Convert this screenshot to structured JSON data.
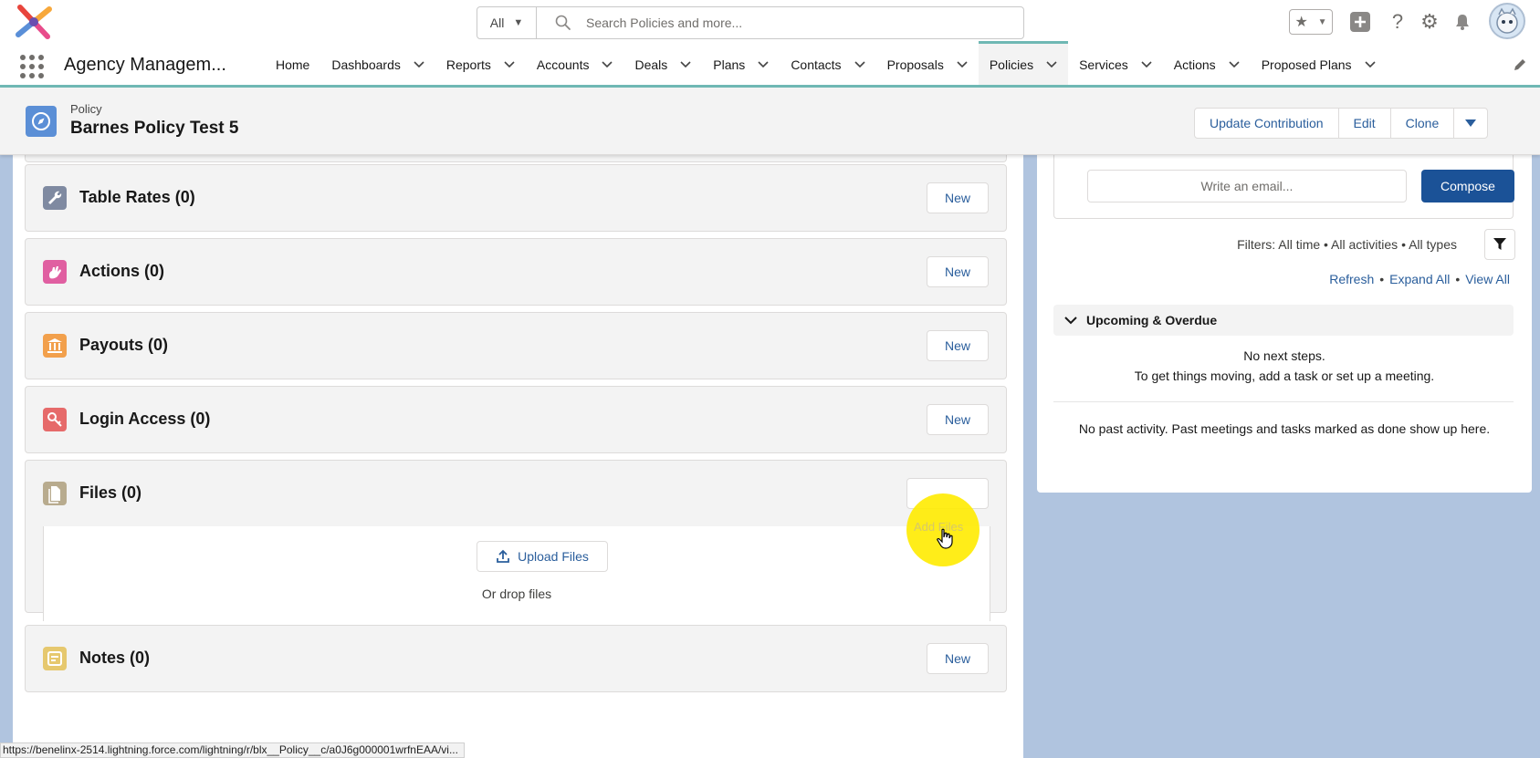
{
  "search": {
    "scope": "All",
    "placeholder": "Search Policies and more..."
  },
  "app": {
    "name": "Agency Managem..."
  },
  "nav": {
    "items": [
      {
        "label": "Home",
        "has_menu": false
      },
      {
        "label": "Dashboards",
        "has_menu": true
      },
      {
        "label": "Reports",
        "has_menu": true
      },
      {
        "label": "Accounts",
        "has_menu": true
      },
      {
        "label": "Deals",
        "has_menu": true
      },
      {
        "label": "Plans",
        "has_menu": true
      },
      {
        "label": "Contacts",
        "has_menu": true
      },
      {
        "label": "Proposals",
        "has_menu": true
      },
      {
        "label": "Policies",
        "has_menu": true,
        "active": true
      },
      {
        "label": "Services",
        "has_menu": true
      },
      {
        "label": "Actions",
        "has_menu": true
      },
      {
        "label": "Proposed Plans",
        "has_menu": true
      }
    ]
  },
  "record": {
    "type": "Policy",
    "title": "Barnes Policy Test 5",
    "actions": [
      "Update Contribution",
      "Edit",
      "Clone"
    ]
  },
  "related": [
    {
      "title": "Table Rates (0)",
      "button": "New",
      "icon": "wrench-icon",
      "color": "#7f8aa1"
    },
    {
      "title": "Actions (0)",
      "button": "New",
      "icon": "hand-icon",
      "color": "#e05fa1"
    },
    {
      "title": "Payouts (0)",
      "button": "New",
      "icon": "bank-icon",
      "color": "#f2a04c"
    },
    {
      "title": "Login Access (0)",
      "button": "New",
      "icon": "key-icon",
      "color": "#e66a6a"
    },
    {
      "title": "Files (0)",
      "button": "Add Files",
      "icon": "file-icon",
      "color": "#b8ab8e"
    },
    {
      "title": "Notes (0)",
      "button": "New",
      "icon": "note-icon",
      "color": "#e6c86e"
    }
  ],
  "files": {
    "upload_label": "Upload Files",
    "drop_text": "Or drop files"
  },
  "activity": {
    "email_placeholder": "Write an email...",
    "compose_label": "Compose",
    "filters": "Filters: All time • All activities • All types",
    "refresh": "Refresh",
    "expand_all": "Expand All",
    "view_all": "View All",
    "upcoming_label": "Upcoming & Overdue",
    "no_steps_1": "No next steps.",
    "no_steps_2": "To get things moving, add a task or set up a meeting.",
    "no_past": "No past activity. Past meetings and tasks marked as done show up here."
  },
  "status_url": "https://benelinx-2514.lightning.force.com/lightning/r/blx__Policy__c/a0J6g000001wrfnEAA/vi...",
  "colors": {
    "accent": "#6fb8b4",
    "link": "#2a5e9c",
    "compose": "#1b5297",
    "highlight": "#ffeb00"
  }
}
